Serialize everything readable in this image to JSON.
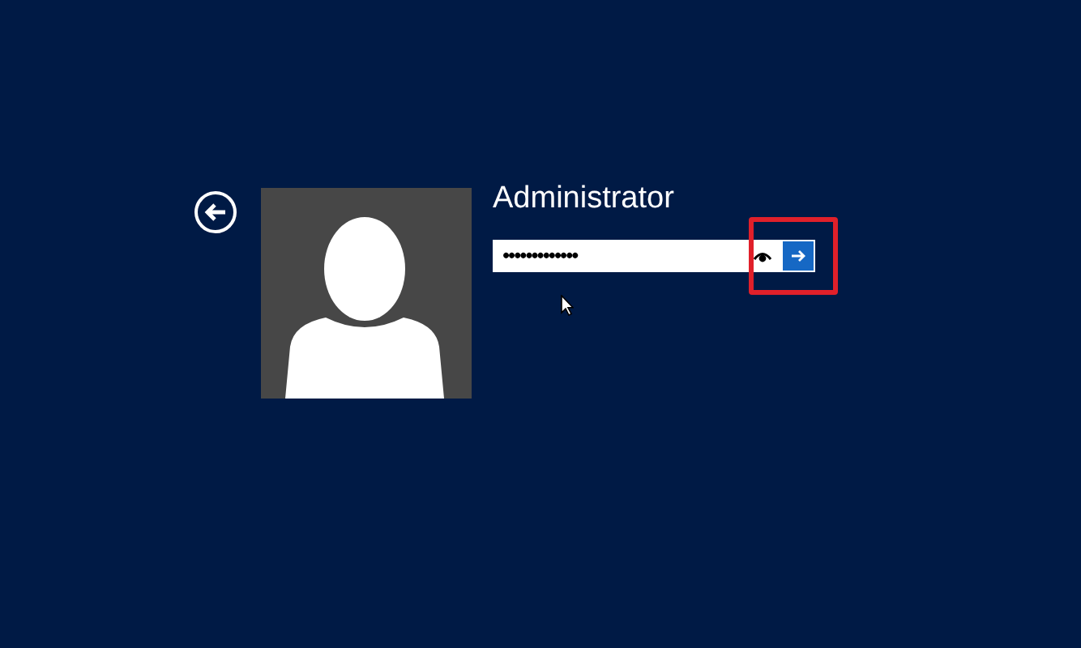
{
  "user": {
    "name": "Administrator"
  },
  "password": {
    "value": "•••••••••••••"
  },
  "highlight": {
    "on": true
  }
}
